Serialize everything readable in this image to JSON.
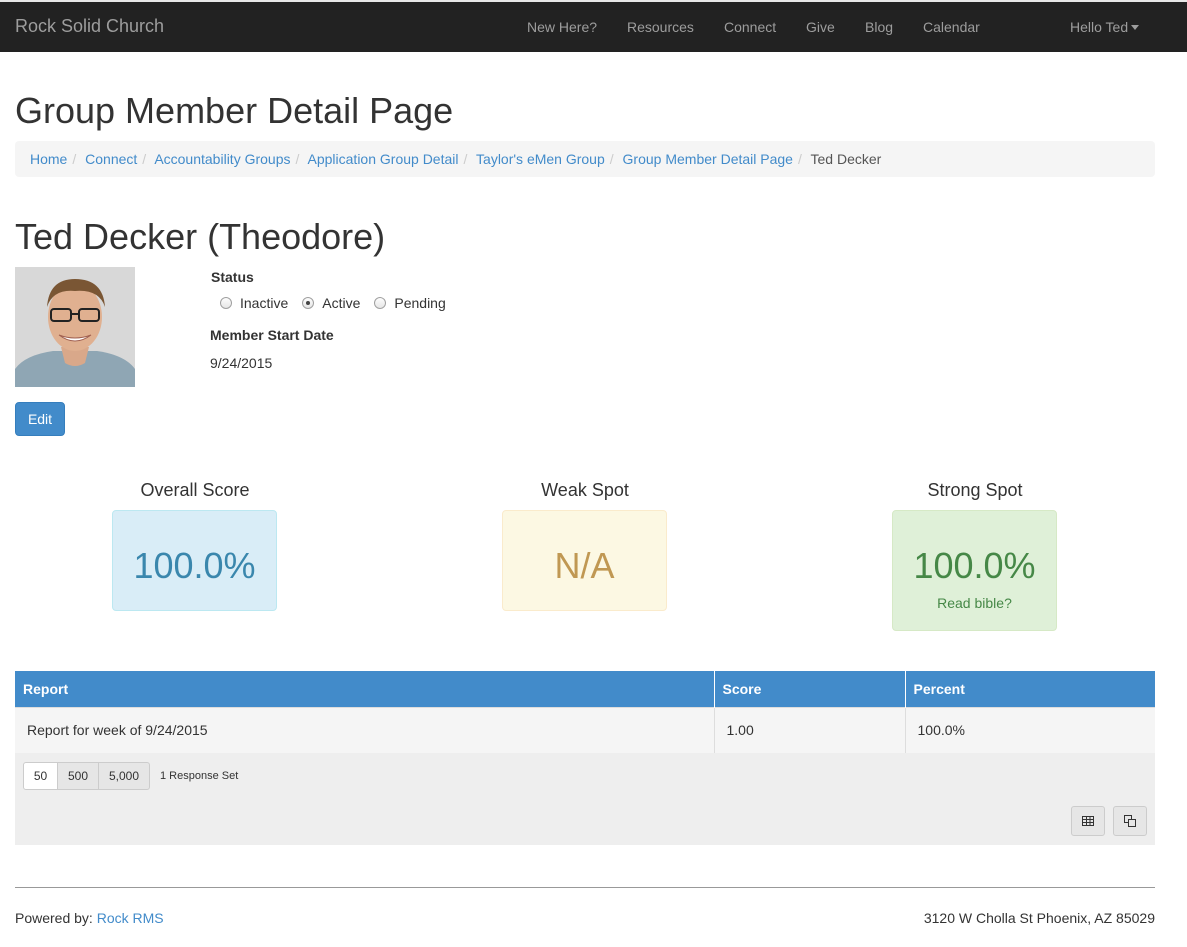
{
  "navbar": {
    "brand": "Rock Solid Church",
    "links": [
      "New Here?",
      "Resources",
      "Connect",
      "Give",
      "Blog",
      "Calendar"
    ],
    "user_menu": "Hello Ted"
  },
  "page": {
    "title": "Group Member Detail Page"
  },
  "breadcrumb": {
    "items": [
      "Home",
      "Connect",
      "Accountability Groups",
      "Application Group Detail",
      "Taylor's eMen Group",
      "Group Member Detail Page"
    ],
    "current": "Ted Decker"
  },
  "member": {
    "name": "Ted Decker (Theodore)",
    "status_label": "Status",
    "status_options": [
      "Inactive",
      "Active",
      "Pending"
    ],
    "status_selected": "Active",
    "start_date_label": "Member Start Date",
    "start_date": "9/24/2015",
    "edit_label": "Edit"
  },
  "scores": {
    "overall": {
      "title": "Overall Score",
      "value": "100.0%"
    },
    "weak": {
      "title": "Weak Spot",
      "value": "N/A"
    },
    "strong": {
      "title": "Strong Spot",
      "value": "100.0%",
      "note": "Read bible?"
    }
  },
  "grid": {
    "columns": [
      "Report",
      "Score",
      "Percent"
    ],
    "rows": [
      [
        "Report for week of 9/24/2015",
        "1.00",
        "100.0%"
      ]
    ],
    "page_sizes": [
      "50",
      "500",
      "5,000"
    ],
    "page_size_selected": "50",
    "count_text": "1 Response Set"
  },
  "footer": {
    "powered_prefix": "Powered by: ",
    "powered_link": "Rock RMS",
    "address": "3120 W Cholla St Phoenix, AZ 85029"
  },
  "colors": {
    "navbar": "#222222",
    "primary": "#428bca",
    "info_bg": "#d9edf7",
    "warning_bg": "#fcf8e3",
    "success_bg": "#dff0d8"
  }
}
